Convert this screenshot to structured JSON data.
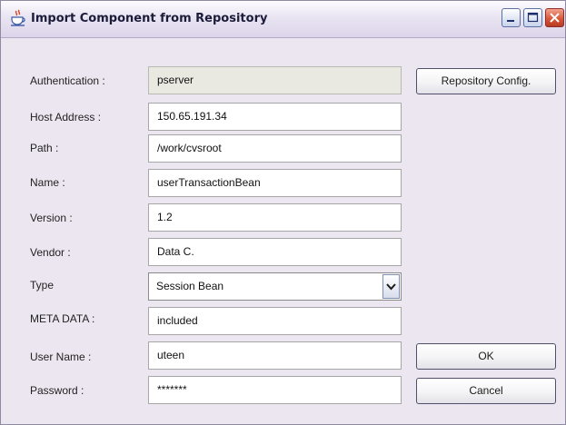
{
  "window": {
    "title": "Import Component from Repository"
  },
  "form": {
    "fields": [
      {
        "label": "Authentication :",
        "value": "pserver"
      },
      {
        "label": "Host Address :",
        "value": "150.65.191.34"
      },
      {
        "label": "Path :",
        "value": "/work/cvsroot"
      },
      {
        "label": "Name :",
        "value": "userTransactionBean"
      },
      {
        "label": "Version :",
        "value": "1.2"
      },
      {
        "label": "Vendor :",
        "value": "Data C."
      },
      {
        "label": "Type",
        "value": "Session Bean"
      },
      {
        "label": "META DATA :",
        "value": "included"
      },
      {
        "label": "User Name :",
        "value": "uteen"
      },
      {
        "label": "Password :",
        "value": "*******"
      }
    ]
  },
  "buttons": {
    "repository_config": "Repository Config.",
    "ok": "OK",
    "cancel": "Cancel"
  },
  "icons": {
    "app": "java-coffee-cup-icon",
    "minimize": "minimize-icon",
    "maximize": "maximize-icon",
    "close": "close-icon",
    "dropdown": "chevron-down-icon"
  },
  "colors": {
    "window_bg": "#ece6f0",
    "readonly_field_bg": "#e9e9e1",
    "close_button": "#d9583a"
  }
}
